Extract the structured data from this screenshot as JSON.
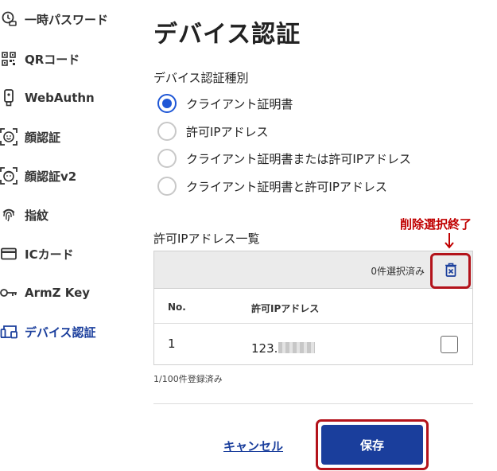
{
  "sidebar": {
    "items": [
      {
        "label": "一時パスワード",
        "icon": "clock-key-icon"
      },
      {
        "label": "QRコード",
        "icon": "qr-code-icon"
      },
      {
        "label": "WebAuthn",
        "icon": "usb-key-icon"
      },
      {
        "label": "顔認証",
        "icon": "face-scan-icon"
      },
      {
        "label": "顔認証v2",
        "icon": "face-scan-v2-icon"
      },
      {
        "label": "指紋",
        "icon": "fingerprint-icon"
      },
      {
        "label": "ICカード",
        "icon": "card-icon"
      },
      {
        "label": "ArmZ Key",
        "icon": "key-icon"
      },
      {
        "label": "デバイス認証",
        "icon": "devices-icon",
        "active": true
      }
    ]
  },
  "main": {
    "title": "デバイス認証",
    "auth_type_label": "デバイス認証種別",
    "auth_options": [
      {
        "label": "クライアント証明書",
        "checked": true
      },
      {
        "label": "許可IPアドレス",
        "checked": false
      },
      {
        "label": "クライアント証明書または許可IPアドレス",
        "checked": false
      },
      {
        "label": "クライアント証明書と許可IPアドレス",
        "checked": false
      }
    ],
    "ip_list_label": "許可IPアドレス一覧",
    "annotation": "削除選択終了",
    "table": {
      "selected_count": "0件選択済み",
      "columns": [
        "No.",
        "許可IPアドレス"
      ],
      "rows": [
        {
          "no": "1",
          "ip_prefix": "123.",
          "checked": false
        }
      ]
    },
    "registered_count": "1/100件登録済み",
    "cancel_label": "キャンセル",
    "save_label": "保存"
  },
  "colors": {
    "accent": "#1a3e9c",
    "radio_checked": "#1f57d6",
    "annotation_red": "#c00000",
    "highlight_border": "#b3131b"
  }
}
